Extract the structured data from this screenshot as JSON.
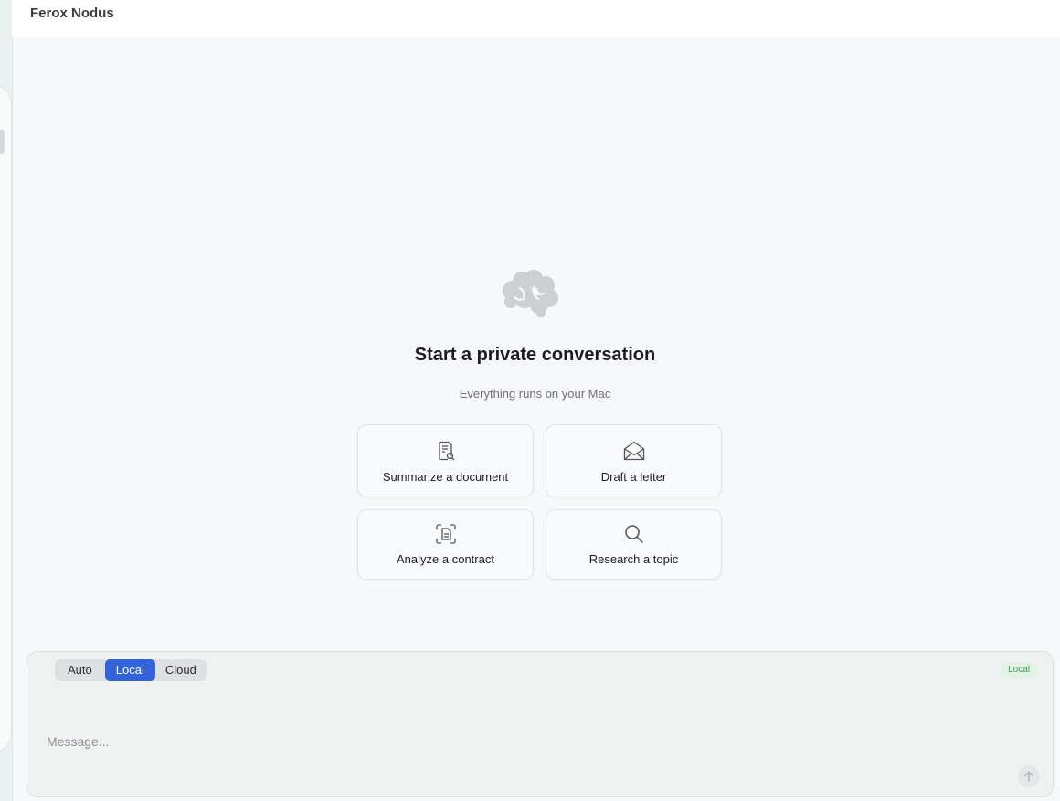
{
  "app": {
    "title": "Ferox Nodus"
  },
  "hero": {
    "title": "Start a private conversation",
    "subtitle": "Everything runs on your Mac"
  },
  "suggestions": [
    {
      "label": "Summarize a document",
      "icon": "document-search-icon"
    },
    {
      "label": "Draft a letter",
      "icon": "open-envelope-icon"
    },
    {
      "label": "Analyze a contract",
      "icon": "document-scan-icon"
    },
    {
      "label": "Research a topic",
      "icon": "magnifier-icon"
    }
  ],
  "composer": {
    "modes": [
      "Auto",
      "Local",
      "Cloud"
    ],
    "selected_mode": "Local",
    "badge": "Local",
    "placeholder": "Message..."
  },
  "colors": {
    "accent": "#3363db",
    "badge_text": "#3fa35b",
    "badge_bg": "#e2f2e4"
  }
}
